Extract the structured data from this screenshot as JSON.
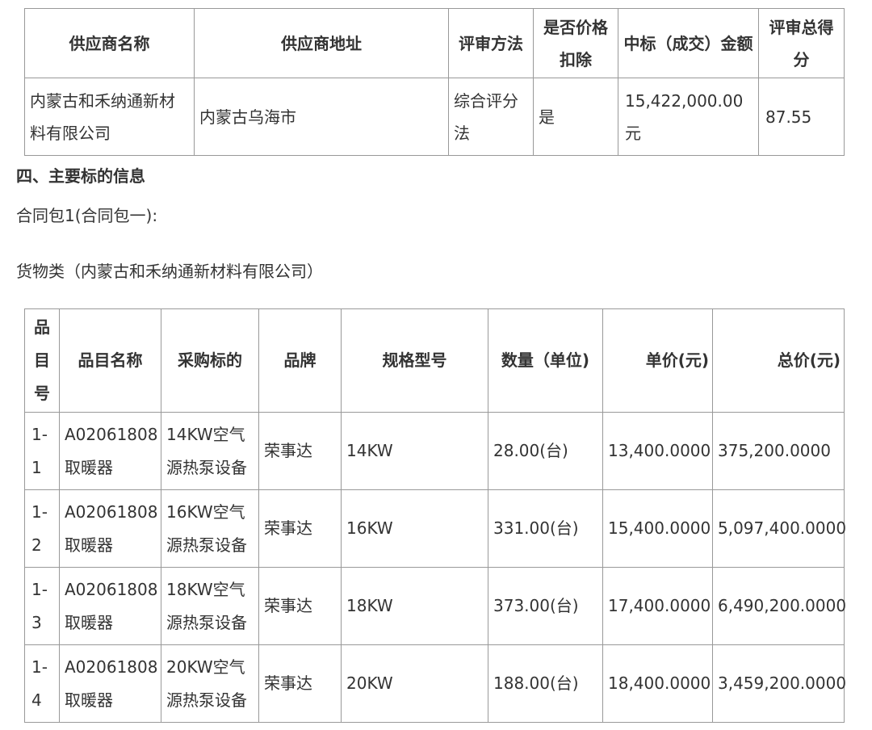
{
  "supplier_table": {
    "headers": [
      "供应商名称",
      "供应商地址",
      "评审方法",
      "是否价格扣除",
      "中标（成交）金额",
      "评审总得分"
    ],
    "row": {
      "name": "内蒙古和禾纳通新材料有限公司",
      "address": "内蒙古乌海市",
      "method": "综合评分法",
      "price_deduction": "是",
      "amount": "15,422,000.00元",
      "score": "87.55"
    }
  },
  "section_heading": "四、主要标的信息",
  "contract_package": "合同包1(合同包一):",
  "goods_line": "货物类（内蒙古和禾纳通新材料有限公司）",
  "items_table": {
    "headers": [
      "品目号",
      "品目名称",
      "采购标的",
      "品牌",
      "规格型号",
      "数量（单位)",
      "单价(元)",
      "总价(元)"
    ],
    "rows": [
      {
        "idx": "1-1",
        "category": "A02061808取暖器",
        "item": "14KW空气源热泵设备",
        "brand": "荣事达",
        "model": "14KW",
        "qty": "28.00(台)",
        "unit_price": "13,400.0000",
        "total": "375,200.0000"
      },
      {
        "idx": "1-2",
        "category": "A02061808取暖器",
        "item": "16KW空气源热泵设备",
        "brand": "荣事达",
        "model": "16KW",
        "qty": "331.00(台)",
        "unit_price": "15,400.0000",
        "total": "5,097,400.0000"
      },
      {
        "idx": "1-3",
        "category": "A02061808取暖器",
        "item": "18KW空气源热泵设备",
        "brand": "荣事达",
        "model": "18KW",
        "qty": "373.00(台)",
        "unit_price": "17,400.0000",
        "total": "6,490,200.0000"
      },
      {
        "idx": "1-4",
        "category": "A02061808取暖器",
        "item": "20KW空气源热泵设备",
        "brand": "荣事达",
        "model": "20KW",
        "qty": "188.00(台)",
        "unit_price": "18,400.0000",
        "total": "3,459,200.0000"
      }
    ]
  }
}
